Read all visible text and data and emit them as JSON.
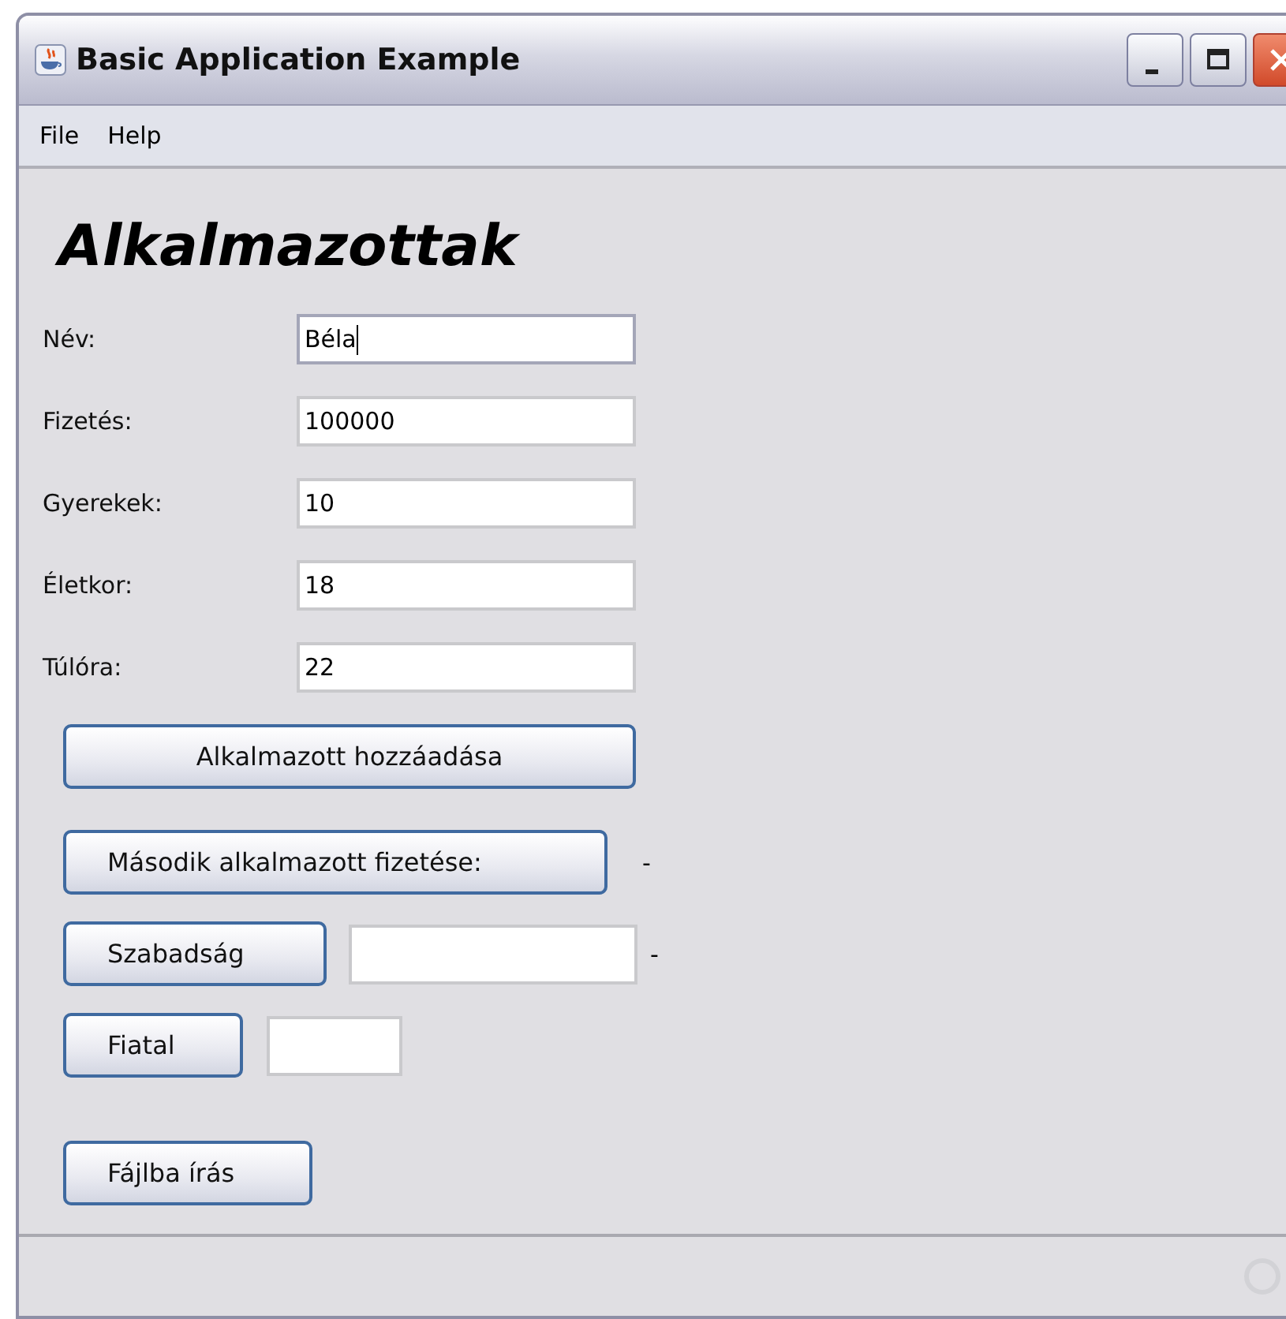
{
  "window": {
    "title": "Basic Application Example"
  },
  "menu": [
    "File",
    "Help"
  ],
  "heading": "Alkalmazottak",
  "fields": [
    {
      "label": "Név:",
      "value": "Béla",
      "focused": true
    },
    {
      "label": "Fizetés:",
      "value": "100000",
      "focused": false
    },
    {
      "label": "Gyerekek:",
      "value": "10",
      "focused": false
    },
    {
      "label": "Életkor:",
      "value": "18",
      "focused": false
    },
    {
      "label": "Túlóra:",
      "value": "22",
      "focused": false
    }
  ],
  "add_button": "Alkalmazott hozzáadása",
  "second_salary": {
    "button": "Második alkalmazott fizetése:",
    "result": "-"
  },
  "vacation": {
    "button": "Szabadság",
    "result": "-"
  },
  "young": {
    "button": "Fiatal"
  },
  "write_button": "Fájlba írás"
}
